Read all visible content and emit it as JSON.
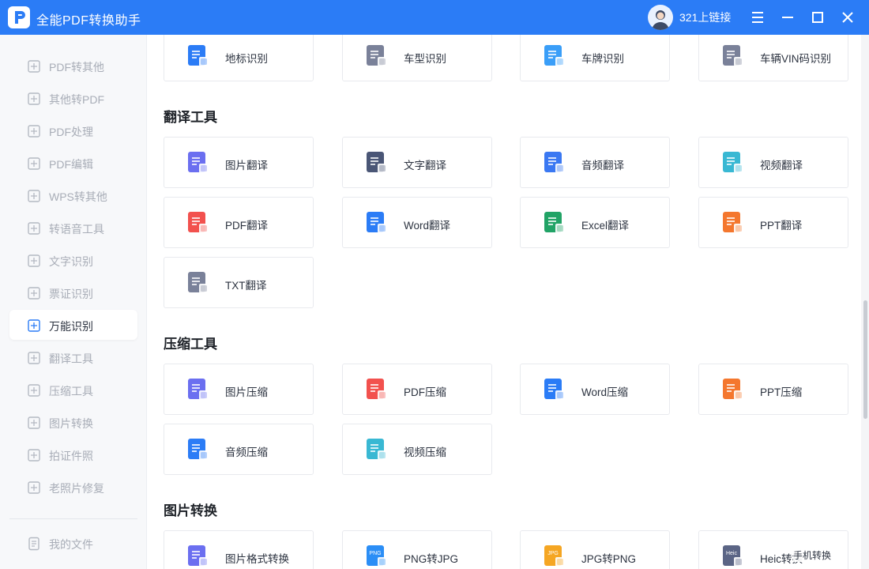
{
  "titlebar": {
    "app_title": "全能PDF转换助手",
    "user_name": "321上链接",
    "bg_color": "#2b7cf6"
  },
  "sidebar": {
    "items": [
      {
        "label": "PDF转其他",
        "icon": "pdf-icon"
      },
      {
        "label": "其他转PDF",
        "icon": "pdf-icon"
      },
      {
        "label": "PDF处理",
        "icon": "pdf-process-icon"
      },
      {
        "label": "PDF编辑",
        "icon": "pdf-edit-icon"
      },
      {
        "label": "WPS转其他",
        "icon": "wps-icon"
      },
      {
        "label": "转语音工具",
        "icon": "voice-icon"
      },
      {
        "label": "文字识别",
        "icon": "text-ocr-icon"
      },
      {
        "label": "票证识别",
        "icon": "ticket-icon"
      },
      {
        "label": "万能识别",
        "icon": "universal-ocr-icon",
        "active": true
      },
      {
        "label": "翻译工具",
        "icon": "translate-icon"
      },
      {
        "label": "压缩工具",
        "icon": "compress-icon"
      },
      {
        "label": "图片转换",
        "icon": "image-convert-icon"
      },
      {
        "label": "拍证件照",
        "icon": "id-photo-icon"
      },
      {
        "label": "老照片修复",
        "icon": "photo-repair-icon"
      }
    ],
    "my_files": "我的文件"
  },
  "top_row": [
    {
      "label": "地标识别",
      "icon": "landmark-icon",
      "color": "#2b7cf6"
    },
    {
      "label": "车型识别",
      "icon": "car-model-icon",
      "color": "#7a8199"
    },
    {
      "label": "车牌识别",
      "icon": "plate-icon",
      "color": "#3a9ef8"
    },
    {
      "label": "车辆VIN码识别",
      "icon": "vin-icon",
      "color": "#7a8199"
    }
  ],
  "sections": {
    "translate": {
      "title": "翻译工具",
      "items": [
        {
          "label": "图片翻译",
          "icon": "image-translate-icon",
          "color": "#6b6ff0"
        },
        {
          "label": "文字翻译",
          "icon": "text-translate-icon",
          "color": "#4a5676"
        },
        {
          "label": "音频翻译",
          "icon": "audio-translate-icon",
          "color": "#3a78f2"
        },
        {
          "label": "视频翻译",
          "icon": "video-translate-icon",
          "color": "#39b8d3"
        },
        {
          "label": "PDF翻译",
          "icon": "pdf-translate-icon",
          "color": "#f2514e"
        },
        {
          "label": "Word翻译",
          "icon": "word-translate-icon",
          "color": "#2b7cf6"
        },
        {
          "label": "Excel翻译",
          "icon": "excel-translate-icon",
          "color": "#21a366"
        },
        {
          "label": "PPT翻译",
          "icon": "ppt-translate-icon",
          "color": "#f4772e"
        },
        {
          "label": "TXT翻译",
          "icon": "txt-translate-icon",
          "color": "#7a8199"
        }
      ]
    },
    "compress": {
      "title": "压缩工具",
      "items": [
        {
          "label": "图片压缩",
          "icon": "image-compress-icon",
          "color": "#6b6ff0"
        },
        {
          "label": "PDF压缩",
          "icon": "pdf-compress-icon",
          "color": "#f2514e"
        },
        {
          "label": "Word压缩",
          "icon": "word-compress-icon",
          "color": "#2b7cf6"
        },
        {
          "label": "PPT压缩",
          "icon": "ppt-compress-icon",
          "color": "#f4772e"
        },
        {
          "label": "音频压缩",
          "icon": "audio-compress-icon",
          "color": "#2b7cf6"
        },
        {
          "label": "视频压缩",
          "icon": "video-compress-icon",
          "color": "#39b8d3"
        }
      ]
    },
    "image_convert": {
      "title": "图片转换",
      "items": [
        {
          "label": "图片格式转换",
          "icon": "image-format-icon",
          "color": "#6b6ff0"
        },
        {
          "label": "PNG转JPG",
          "icon": "png-icon",
          "color": "#2b8ef6",
          "badge": "PNG"
        },
        {
          "label": "JPG转PNG",
          "icon": "jpg-icon",
          "color": "#f5a623",
          "badge": "JPG"
        },
        {
          "label": "Heic转换",
          "icon": "heic-icon",
          "color": "#5b6585",
          "badge": "Heic"
        }
      ]
    }
  },
  "floating_label": "手机转换"
}
